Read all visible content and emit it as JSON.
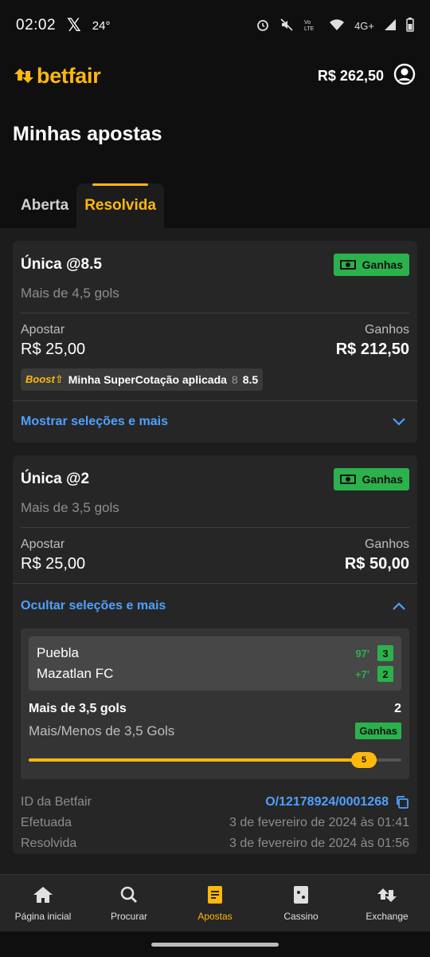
{
  "status_bar": {
    "time": "02:02",
    "x_label": "𝕏",
    "temp": "24°",
    "network": "4G+"
  },
  "header": {
    "brand": "betfair",
    "balance": "R$ 262,50"
  },
  "page": {
    "title": "Minhas apostas"
  },
  "tabs": [
    {
      "label": "Aberta"
    },
    {
      "label": "Resolvida"
    }
  ],
  "bets": [
    {
      "title": "Única @8.5",
      "subtitle": "Mais de 4,5 gols",
      "status": "Ganhas",
      "stake_label": "Apostar",
      "stake": "R$ 25,00",
      "win_label": "Ganhos",
      "winnings": "R$ 212,50",
      "boost_tag": "Boost",
      "boost_text": "Minha SuperCotação aplicada",
      "boost_old": "8",
      "boost_new": "8.5",
      "toggle": "Mostrar seleções e mais"
    },
    {
      "title": "Única @2",
      "subtitle": "Mais de 3,5 gols",
      "status": "Ganhas",
      "stake_label": "Apostar",
      "stake": "R$ 25,00",
      "win_label": "Ganhos",
      "winnings": "R$ 50,00",
      "toggle": "Ocultar seleções e mais",
      "selection": {
        "home": "Puebla",
        "home_time": "97'",
        "home_score": "3",
        "away": "Mazatlan FC",
        "away_time": "+7'",
        "away_score": "2",
        "market": "Mais de 3,5 gols",
        "odds": "2",
        "market_type": "Mais/Menos de 3,5 Gols",
        "status": "Ganhas",
        "progress_value": "5",
        "progress_fraction": 0.9
      },
      "meta": [
        {
          "label": "ID da Betfair",
          "value": "O/12178924/0001268"
        },
        {
          "label": "Efetuada",
          "value": "3 de fevereiro de 2024 às 01:41"
        },
        {
          "label": "Resolvida",
          "value": "3 de fevereiro de 2024 às 01:56"
        }
      ]
    }
  ],
  "nav": [
    {
      "label": "Página inicial",
      "icon": "home-icon"
    },
    {
      "label": "Procurar",
      "icon": "search-icon"
    },
    {
      "label": "Apostas",
      "icon": "bets-icon"
    },
    {
      "label": "Cassino",
      "icon": "casino-icon"
    },
    {
      "label": "Exchange",
      "icon": "exchange-icon"
    }
  ],
  "colors": {
    "accent": "#ffb80c",
    "success": "#2bb24c",
    "link": "#4ea1ff"
  }
}
